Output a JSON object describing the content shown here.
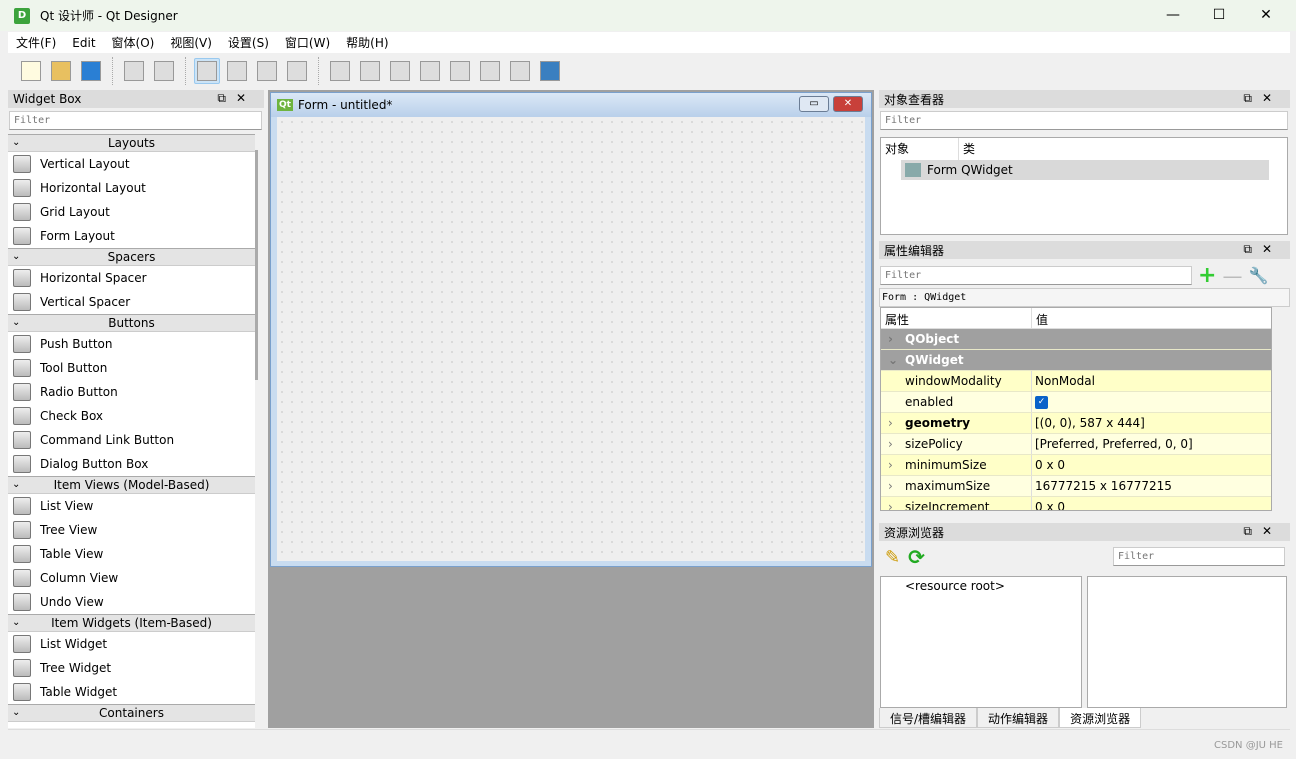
{
  "window": {
    "title": "Qt 设计师 - Qt Designer",
    "logo": "D",
    "minimize": "—",
    "maximize": "☐",
    "close": "✕"
  },
  "menu": [
    "文件(F)",
    "Edit",
    "窗体(O)",
    "视图(V)",
    "设置(S)",
    "窗口(W)",
    "帮助(H)"
  ],
  "toolbar_icons": [
    "new-file-icon",
    "open-folder-icon",
    "save-icon",
    "|",
    "send-to-back-icon",
    "bring-to-front-icon",
    "|",
    "edit-widgets-icon",
    "edit-signals-slots-icon",
    "edit-buddies-icon",
    "edit-tab-order-icon",
    "|",
    "layout-horizontal-icon",
    "layout-vertical-icon",
    "layout-horizontal-splitter-icon",
    "layout-vertical-splitter-icon",
    "layout-grid-icon",
    "layout-form-icon",
    "break-layout-icon",
    "adjust-size-icon"
  ],
  "widget_box": {
    "title": "Widget Box",
    "filter_placeholder": "Filter",
    "categories": [
      {
        "name": "Layouts",
        "items": [
          "Vertical Layout",
          "Horizontal Layout",
          "Grid Layout",
          "Form Layout"
        ]
      },
      {
        "name": "Spacers",
        "items": [
          "Horizontal Spacer",
          "Vertical Spacer"
        ]
      },
      {
        "name": "Buttons",
        "items": [
          "Push Button",
          "Tool Button",
          "Radio Button",
          "Check Box",
          "Command Link Button",
          "Dialog Button Box"
        ]
      },
      {
        "name": "Item Views (Model-Based)",
        "items": [
          "List View",
          "Tree View",
          "Table View",
          "Column View",
          "Undo View"
        ]
      },
      {
        "name": "Item Widgets (Item-Based)",
        "items": [
          "List Widget",
          "Tree Widget",
          "Table Widget"
        ]
      },
      {
        "name": "Containers",
        "items": []
      }
    ]
  },
  "form": {
    "title": "Form - untitled*",
    "icon_label": "Qt"
  },
  "object_inspector": {
    "title": "对象查看器",
    "filter_placeholder": "Filter",
    "col_object": "对象",
    "col_class": "类",
    "row_object": "Form",
    "row_class": "QWidget"
  },
  "property_editor": {
    "title": "属性编辑器",
    "filter_placeholder": "Filter",
    "context": "Form : QWidget",
    "col_property": "属性",
    "col_value": "值",
    "rows": [
      {
        "group": true,
        "name": "QObject",
        "expanded": false
      },
      {
        "group": true,
        "name": "QWidget",
        "expanded": true
      },
      {
        "name": "windowModality",
        "value": "NonModal"
      },
      {
        "name": "enabled",
        "value": "✓",
        "checkbox": true
      },
      {
        "name": "geometry",
        "value": "[(0, 0), 587 x 444]",
        "bold": true,
        "expandable": true
      },
      {
        "name": "sizePolicy",
        "value": "[Preferred, Preferred, 0, 0]",
        "expandable": true
      },
      {
        "name": "minimumSize",
        "value": "0 x 0",
        "expandable": true
      },
      {
        "name": "maximumSize",
        "value": "16777215 x 16777215",
        "expandable": true
      },
      {
        "name": "sizeIncrement",
        "value": "0 x 0",
        "expandable": true
      }
    ]
  },
  "resource_browser": {
    "title": "资源浏览器",
    "filter_placeholder": "Filter",
    "root": "<resource root>"
  },
  "bottom_tabs": [
    "信号/槽编辑器",
    "动作编辑器",
    "资源浏览器"
  ],
  "watermark": "CSDN @JU HE"
}
